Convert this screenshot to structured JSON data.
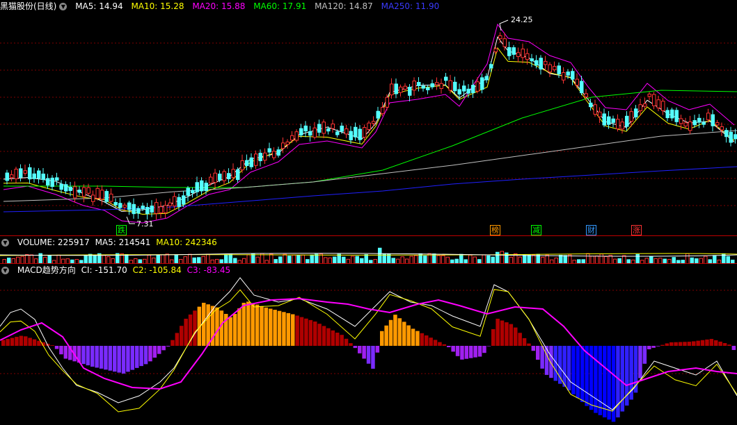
{
  "price": {
    "title": "黑猫股份(日线)",
    "ma": [
      {
        "label": "MA5: 14.94",
        "color": "#ffffff"
      },
      {
        "label": "MA10: 15.28",
        "color": "#ffff00"
      },
      {
        "label": "MA20: 15.88",
        "color": "#ff00ff"
      },
      {
        "label": "MA60: 17.91",
        "color": "#00ff00"
      },
      {
        "label": "MA120: 14.87",
        "color": "#c0c0c0"
      },
      {
        "label": "MA250: 11.90",
        "color": "#3a3aff"
      }
    ],
    "high_label": "24.25",
    "low_label": "7.31",
    "markers": [
      {
        "text": "跌",
        "color": "#00ff00"
      },
      {
        "text": "榜",
        "color": "#ff9900"
      },
      {
        "text": "减",
        "color": "#00ff00"
      },
      {
        "text": "财",
        "color": "#3399ff"
      },
      {
        "text": "涨",
        "color": "#ff3333"
      }
    ],
    "colors": {
      "up": "#ff3232",
      "down": "#54ffff"
    }
  },
  "volume": {
    "labels": [
      {
        "label": "VOLUME: 225917",
        "color": "#ffffff"
      },
      {
        "label": "MA5: 214541",
        "color": "#ffffff"
      },
      {
        "label": "MA10: 242346",
        "color": "#ffff00"
      }
    ]
  },
  "macd": {
    "labels": [
      {
        "label": "MACD趋势方向",
        "color": "#ffffff"
      },
      {
        "label": "CI: -151.70",
        "color": "#ffffff"
      },
      {
        "label": "C2: -105.84",
        "color": "#ffff00"
      },
      {
        "label": "C3: -83.45",
        "color": "#ff00ff"
      }
    ]
  }
}
